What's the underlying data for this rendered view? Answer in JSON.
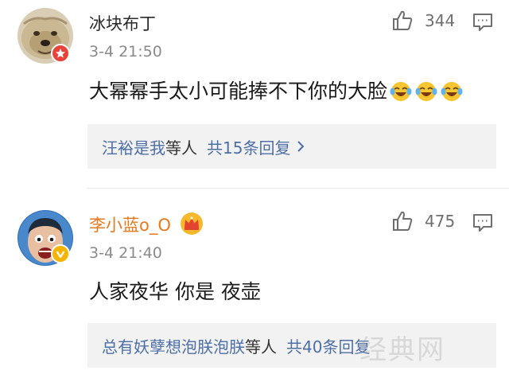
{
  "comments": [
    {
      "username": "冰块布丁",
      "time": "3-4 21:50",
      "likes": "344",
      "text": "大幂幂手太小可能捧不下你的大脸",
      "emoji": [
        "laughing-tears-emoji",
        "laughing-tears-emoji",
        "laughing-tears-emoji"
      ],
      "badge": "weibo-star-badge",
      "replies": {
        "names": "汪裕是我",
        "etc": "等人",
        "total": "共15条回复"
      }
    },
    {
      "username": "李小蓝o_O",
      "time": "3-4 21:40",
      "likes": "475",
      "text": "人家夜华 你是 夜壶",
      "badge": "verified-v-badge",
      "member_icon": "crown-icon",
      "replies": {
        "names": "总有妖孽想泡朕泡朕",
        "etc": "等人",
        "total": "共40条回复"
      }
    }
  ],
  "watermark": "经典网",
  "colors": {
    "accent_link": "#4d6fa8",
    "username_vip": "#e8781c",
    "badge_red": "#e8433a",
    "badge_yellow": "#f4b400",
    "reply_bg": "#f2f2f2"
  }
}
